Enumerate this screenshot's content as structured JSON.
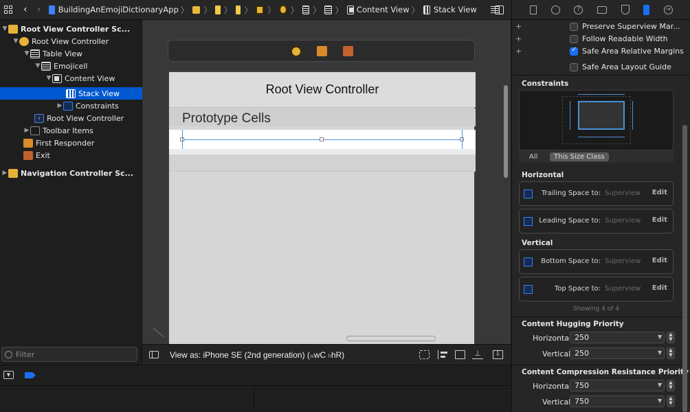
{
  "jumpbar": {
    "project": "BuildingAnEmojiDictionaryApp",
    "content_view": "Content View",
    "stack_view": "Stack View"
  },
  "navigator": {
    "rows": [
      {
        "label": "Root View Controller Sc...",
        "bold": true
      },
      {
        "label": "Root View Controller"
      },
      {
        "label": "Table View"
      },
      {
        "label": "Emojicell"
      },
      {
        "label": "Content View"
      },
      {
        "label": "Stack View"
      },
      {
        "label": "Constraints"
      },
      {
        "label": "Root View Controller"
      },
      {
        "label": "Toolbar Items"
      },
      {
        "label": "First Responder"
      },
      {
        "label": "Exit"
      },
      {
        "label": "Navigation Controller Sc...",
        "bold": true
      }
    ],
    "filter_placeholder": "Filter"
  },
  "canvas": {
    "nav_title": "Root View Controller",
    "section_header": "Prototype Cells",
    "view_as": "View as: iPhone SE (2nd generation) (",
    "size_w": "wC",
    "size_h": "hR",
    "view_as_close": ")"
  },
  "inspector": {
    "checks": [
      {
        "label": "Preserve Superview Mar...",
        "checked": false
      },
      {
        "label": "Follow Readable Width",
        "checked": false
      },
      {
        "label": "Safe Area Relative Margins",
        "checked": true
      },
      {
        "label": "Safe Area Layout Guide",
        "checked": false
      }
    ],
    "constraints_title": "Constraints",
    "seg_all": "All",
    "seg_this_size": "This Size Class",
    "horizontal_title": "Horizontal",
    "vertical_title": "Vertical",
    "constraints": [
      {
        "label": "Trailing Space to:",
        "value": "Superview",
        "edit": "Edit"
      },
      {
        "label": "Leading Space to:",
        "value": "Superview",
        "edit": "Edit"
      },
      {
        "label": "Bottom Space to:",
        "value": "Superview",
        "edit": "Edit"
      },
      {
        "label": "Top Space to:",
        "value": "Superview",
        "edit": "Edit"
      }
    ],
    "showing": "Showing 4 of 4",
    "hugging_title": "Content Hugging Priority",
    "compression_title": "Content Compression Resistance Priority",
    "horizontal_label": "Horizontal",
    "vertical_label": "Vertical",
    "hug_h": "250",
    "hug_v": "250",
    "comp_h": "750",
    "comp_v": "750"
  },
  "colors": {
    "selection": "#0058d0",
    "accent": "#1a6ff3",
    "canvas_bg": "#383838"
  }
}
